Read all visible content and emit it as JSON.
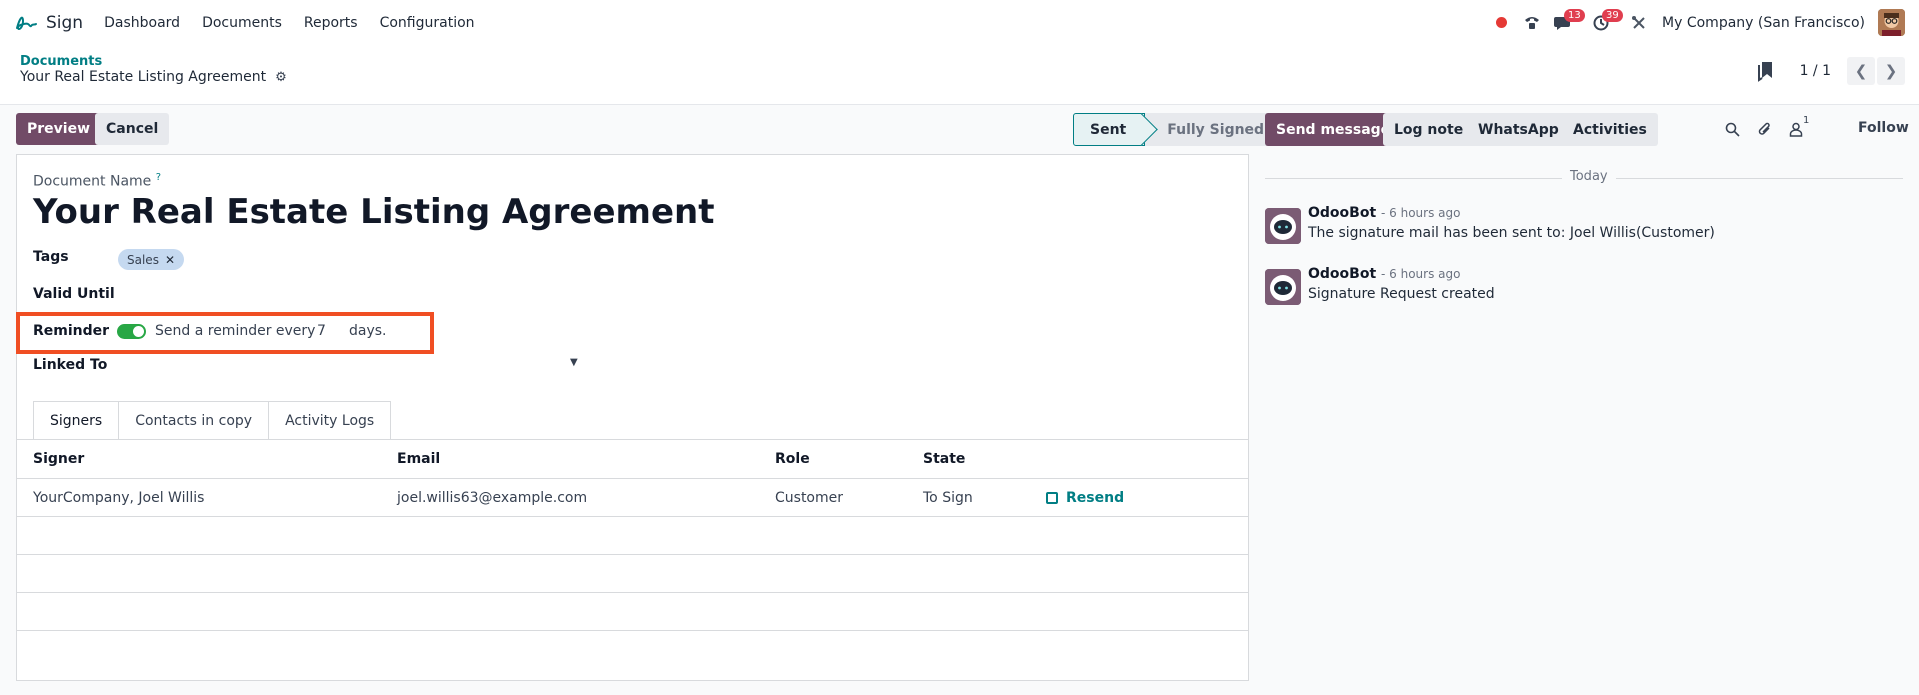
{
  "navbar": {
    "app_name": "Sign",
    "menu": [
      "Dashboard",
      "Documents",
      "Reports",
      "Configuration"
    ],
    "messages_count": "13",
    "activities_count": "39",
    "company": "My Company (San Francisco)"
  },
  "breadcrumb": {
    "parent": "Documents",
    "current": "Your Real Estate Listing Agreement"
  },
  "pager": {
    "value": "1 / 1"
  },
  "actions": {
    "preview": "Preview",
    "cancel": "Cancel"
  },
  "status": {
    "active": "Sent",
    "next": "Fully Signed"
  },
  "form": {
    "document_name_label": "Document Name",
    "help_mark": "?",
    "title": "Your Real Estate Listing Agreement",
    "tags_label": "Tags",
    "tag": "Sales",
    "valid_until_label": "Valid Until",
    "reminder_label": "Reminder",
    "reminder_enabled": true,
    "reminder_prefix": "Send a reminder every",
    "reminder_days": "7",
    "reminder_suffix": "days.",
    "linked_to_label": "Linked To"
  },
  "tabs": [
    "Signers",
    "Contacts in copy",
    "Activity Logs"
  ],
  "table": {
    "headers": [
      "Signer",
      "Email",
      "Role",
      "State"
    ],
    "rows": [
      {
        "signer": "YourCompany, Joel Willis",
        "email": "joel.willis63@example.com",
        "role": "Customer",
        "state": "To Sign",
        "action": "Resend"
      }
    ]
  },
  "chatter": {
    "send_message": "Send message",
    "log_note": "Log note",
    "whatsapp": "WhatsApp",
    "activities": "Activities",
    "followers_count": "1",
    "follow": "Follow",
    "date_separator": "Today",
    "messages": [
      {
        "author": "OdooBot",
        "time": "- 6 hours ago",
        "body": "The signature mail has been sent to: Joel Willis(Customer)"
      },
      {
        "author": "OdooBot",
        "time": "- 6 hours ago",
        "body": "Signature Request created"
      }
    ]
  },
  "colors": {
    "brand": "#714b67",
    "accent": "#017e84",
    "highlight": "#f04e23",
    "toggle_on": "#28a745"
  }
}
